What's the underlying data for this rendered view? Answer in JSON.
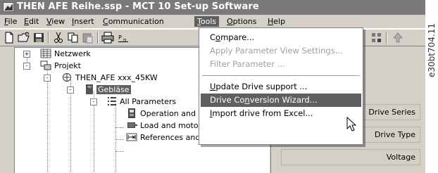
{
  "window": {
    "title": "THEN AFE Reihe.ssp - MCT 10 Set-up Software"
  },
  "menubar": {
    "items": [
      "File",
      "Edit",
      "View",
      "Insert",
      "Communication",
      "Tools",
      "Options",
      "Help"
    ],
    "active": "Tools"
  },
  "toolbar": {
    "icons": [
      "new-icon",
      "open-icon",
      "save-icon",
      "cut-icon",
      "copy-icon",
      "paste-icon",
      "print-icon",
      "parameter-icon",
      "drive-icon",
      "grid-icon",
      "up-arrow-icon"
    ]
  },
  "tools_menu": {
    "items": [
      {
        "label": "Compare...",
        "enabled": true
      },
      {
        "label": "Apply Parameter View Settings...",
        "enabled": false
      },
      {
        "label": "Filter Parameter ...",
        "enabled": false
      },
      {
        "label": "Update Drive support ...",
        "enabled": true
      },
      {
        "label": "Drive Conversion Wizard...",
        "enabled": true,
        "highlighted": true
      },
      {
        "label": "Import drive from Excel...",
        "enabled": true
      }
    ]
  },
  "tree": {
    "nodes": [
      {
        "label": "Netzwerk",
        "expander": "+"
      },
      {
        "label": "Projekt",
        "expander": "-"
      },
      {
        "label": "THEN_AFE xxx_45KW",
        "expander": "-"
      },
      {
        "label": "Gebläse",
        "expander": "-",
        "selected": true
      },
      {
        "label": "All Parameters",
        "expander": "-"
      },
      {
        "label": "Operation and display"
      },
      {
        "label": "Load and motor"
      },
      {
        "label": "References and limits"
      }
    ]
  },
  "right_pane": {
    "fields": [
      "Drive Series",
      "Drive Type",
      "Voltage"
    ]
  },
  "side_tag": "e30bt704.11",
  "colors": {
    "title_bar": "#7a7a7a",
    "highlight": "#5f5f5f",
    "face": "#d4d0c8"
  }
}
